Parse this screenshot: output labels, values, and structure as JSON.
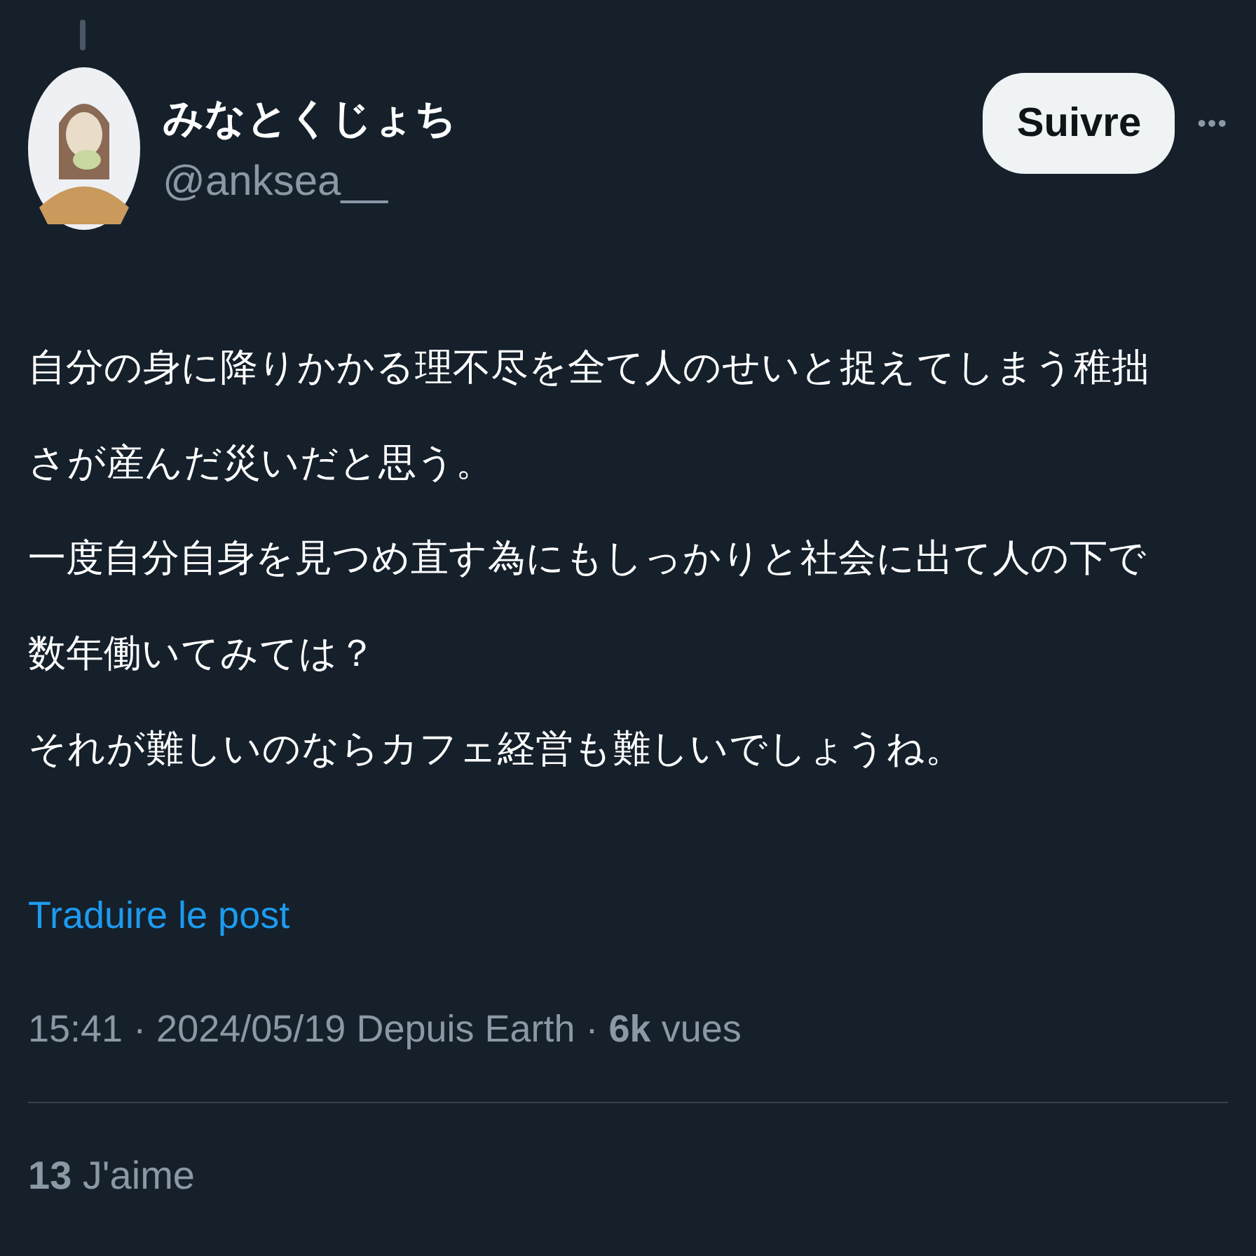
{
  "author": {
    "name": "みなとくじょち",
    "handle": "@anksea__"
  },
  "follow_button": "Suivre",
  "more_button": "•••",
  "body": [
    "自分の身に降りかかる理不尽を全て人のせいと捉えてしまう稚拙",
    "さが産んだ災いだと思う。",
    "一度自分自身を見つめ直す為にもしっかりと社会に出て人の下で",
    "数年働いてみては？",
    "それが難しいのならカフェ経営も難しいでしょうね。"
  ],
  "translate_link": "Traduire le post",
  "meta": "15:41 · 2024/05/19 Depuis Earth · **6k** vues",
  "likes": "**13** J'aime"
}
